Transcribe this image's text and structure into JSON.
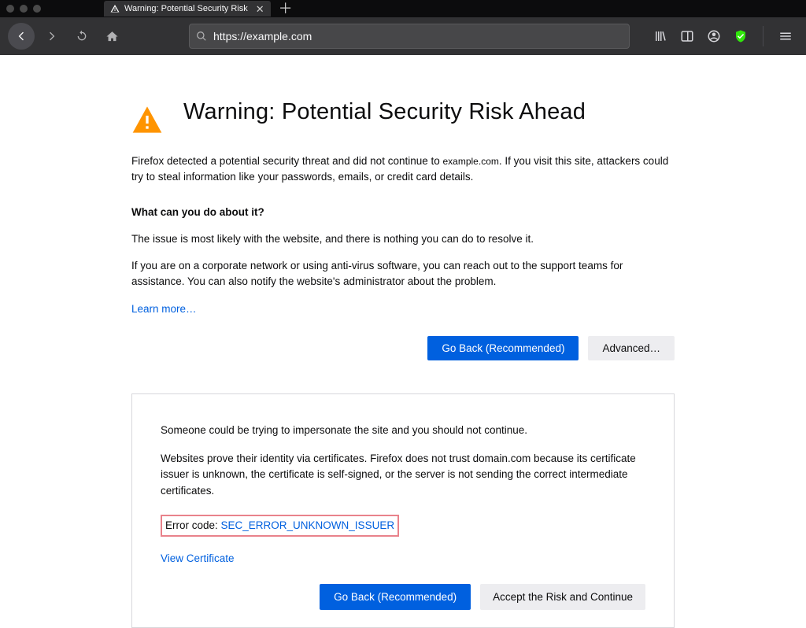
{
  "tab": {
    "title": "Warning: Potential Security Risk"
  },
  "toolbar": {
    "url": "https://example.com"
  },
  "page": {
    "heading": "Warning: Potential Security Risk Ahead",
    "intro_pre": "Firefox detected a potential security threat and did not continue to ",
    "intro_domain": "example.com",
    "intro_post": ". If you visit this site, attackers could try to steal information like your passwords, emails, or credit card details.",
    "sub_heading": "What can you do about it?",
    "para2": "The issue is most likely with the website, and there is nothing you can do to resolve it.",
    "para3": "If you are on a corporate network or using anti-virus software, you can reach out to the support teams for assistance. You can also notify the website's administrator about the problem.",
    "learn_more": "Learn more…",
    "go_back": "Go Back (Recommended)",
    "advanced": "Advanced…"
  },
  "adv": {
    "p1": "Someone could be trying to impersonate the site and you should not continue.",
    "p2": "Websites prove their identity via certificates. Firefox does not trust domain.com because its certificate issuer is unknown, the certificate is self-signed, or the server is not sending the correct intermediate certificates.",
    "error_label": "Error code: ",
    "error_code": "SEC_ERROR_UNKNOWN_ISSUER",
    "view_cert": "View Certificate",
    "go_back": "Go Back (Recommended)",
    "accept": "Accept the Risk and Continue"
  }
}
